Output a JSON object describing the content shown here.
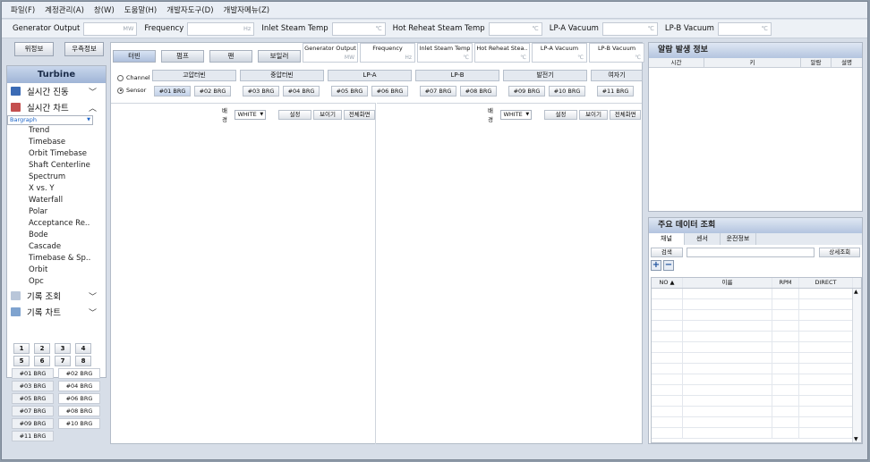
{
  "menu": [
    "파일(F)",
    "계정관리(A)",
    "창(W)",
    "도움말(H)",
    "개발자도구(D)",
    "개발자메뉴(Z)"
  ],
  "topbar": [
    {
      "label": "Generator Output",
      "unit": "MW"
    },
    {
      "label": "Frequency",
      "unit": "Hz"
    },
    {
      "label": "Inlet Steam Temp",
      "unit": "℃"
    },
    {
      "label": "Hot Reheat Steam Temp",
      "unit": "℃"
    },
    {
      "label": "LP-A Vacuum",
      "unit": "℃"
    },
    {
      "label": "LP-B Vacuum",
      "unit": "℃"
    }
  ],
  "left": {
    "btn_location": "위정보",
    "btn_right": "우측정보",
    "tree_title": "Turbine",
    "cat_realtime_vib": "실시간 진동",
    "cat_realtime_chart": "실시간 차트",
    "subitems": [
      "Bargraph",
      "Trend",
      "Timebase",
      "Orbit Timebase",
      "Shaft Centerline",
      "Spectrum",
      "X vs. Y",
      "Waterfall",
      "Polar",
      "Acceptance Re..",
      "Bode",
      "Cascade",
      "Timebase & Sp..",
      "Orbit",
      "Opc"
    ],
    "cat_history": "기록 조회",
    "cat_history_chart": "기록 차트",
    "nums": [
      "1",
      "2",
      "3",
      "4",
      "5",
      "6",
      "7",
      "8"
    ],
    "brgs": [
      "#01 BRG",
      "#02 BRG",
      "#03 BRG",
      "#04 BRG",
      "#05 BRG",
      "#06 BRG",
      "#07 BRG",
      "#08 BRG",
      "#09 BRG",
      "#10 BRG",
      "#11 BRG"
    ]
  },
  "center": {
    "tabs": [
      "터빈",
      "펌프",
      "팬",
      "보일러"
    ],
    "metrics": [
      {
        "label": "Generator Output",
        "unit": "MW"
      },
      {
        "label": "Frequency",
        "unit": "Hz"
      },
      {
        "label": "Inlet Steam Temp",
        "unit": "℃"
      },
      {
        "label": "Hot Reheat Stea..",
        "unit": "℃"
      },
      {
        "label": "LP-A Vacuum",
        "unit": "℃"
      },
      {
        "label": "LP-B Vacuum",
        "unit": "℃"
      }
    ],
    "radio_channel": "Channel",
    "radio_sensor": "Sensor",
    "groups": [
      "고압터빈",
      "중압터빈",
      "LP-A",
      "LP-B",
      "발전기",
      "여자기"
    ],
    "sensors": [
      "#01 BRG",
      "#02 BRG",
      "#03 BRG",
      "#04 BRG",
      "#05 BRG",
      "#06 BRG",
      "#07 BRG",
      "#08 BRG",
      "#09 BRG",
      "#10 BRG",
      "#11 BRG"
    ],
    "bg_label": "배경",
    "bg_value": "WHITE",
    "btn_settings": "설정",
    "btn_show": "보이기",
    "btn_full": "전체화면"
  },
  "alarm": {
    "title": "알람 발생 정보",
    "cols": [
      "시간",
      "키",
      "알람",
      "설명"
    ]
  },
  "data": {
    "title": "주요 데이터 조회",
    "tabs": [
      "채널",
      "센서",
      "운전정보"
    ],
    "search_label": "검색",
    "detail_btn": "상세조회",
    "cols": [
      "NO",
      "이름",
      "RPM",
      "DIRECT"
    ]
  }
}
